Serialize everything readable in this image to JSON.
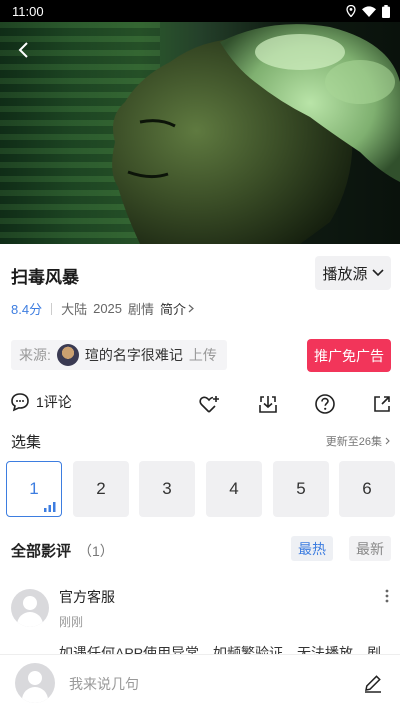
{
  "status_bar": {
    "time": "11:00"
  },
  "video": {
    "back_icon": "back-arrow-icon"
  },
  "title": "扫毒风暴",
  "source_button": {
    "label": "播放源"
  },
  "meta": {
    "score": "8.4分",
    "region": "大陆",
    "year": "2025",
    "genre": "剧情",
    "intro_label": "简介"
  },
  "source": {
    "prefix": "来源:",
    "uploader": "瑄的名字很难记",
    "suffix": "上传"
  },
  "ad_button": {
    "label": "推广免广告"
  },
  "actions": {
    "comment_count_label": "1评论",
    "icons": [
      "heart-plus-icon",
      "download-icon",
      "help-icon",
      "share-icon"
    ]
  },
  "episodes": {
    "title": "选集",
    "update_label": "更新至26集",
    "items": [
      "1",
      "2",
      "3",
      "4",
      "5",
      "6"
    ],
    "selected": "1"
  },
  "reviews": {
    "title": "全部影评",
    "count": "（1）",
    "sort_hot": "最热",
    "sort_new": "最新",
    "items": [
      {
        "author": "官方客服",
        "time": "刚刚",
        "text": "如遇任何APP使用异常，如频繁验证，无法播放，剧"
      }
    ]
  },
  "bottom_bar": {
    "placeholder": "我来说几句"
  },
  "colors": {
    "accent": "#3d7de0",
    "ad": "#f2355a"
  }
}
